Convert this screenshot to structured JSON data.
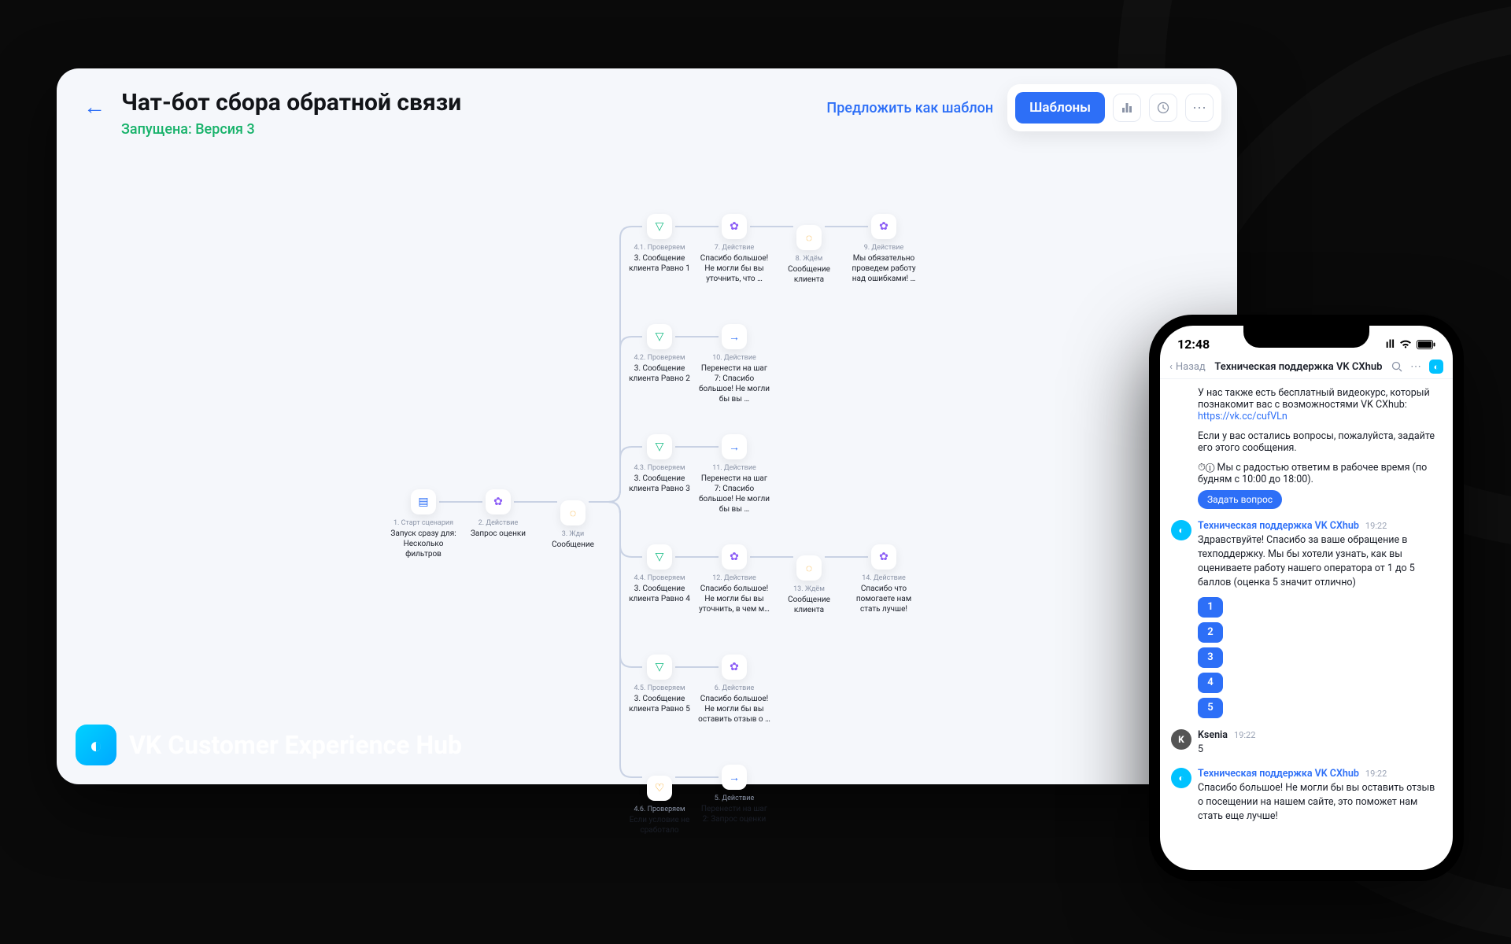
{
  "header": {
    "title": "Чат-бот сбора обратной связи",
    "status": "Запущена: Версия 3"
  },
  "toolbar": {
    "suggest": "Предложить как шаблон",
    "templates": "Шаблоны"
  },
  "brand": {
    "name": "VK Customer Experience Hub",
    "logo": "◐"
  },
  "flow": {
    "base": [
      {
        "cap": "1. Старт сценария",
        "txt": "Запуск сразу для: Несколько фильтров",
        "ic": "cal",
        "g": "▤"
      },
      {
        "cap": "2. Действие",
        "txt": "Запрос оценки",
        "ic": "act",
        "g": "✿"
      },
      {
        "cap": "3. Жди",
        "txt": "Сообщение",
        "ic": "msg",
        "g": "◌"
      }
    ],
    "branches": [
      {
        "check": {
          "cap": "4.1. Проверяем",
          "txt": "3. Сообщение клиента Равно 1"
        },
        "steps": [
          {
            "cap": "7. Действие",
            "txt": "Спасибо большое! Не могли бы вы уточнить, что …",
            "ic": "act",
            "g": "✿"
          },
          {
            "cap": "8. Ждём",
            "txt": "Сообщение клиента",
            "ic": "msg",
            "g": "◌"
          },
          {
            "cap": "9. Действие",
            "txt": "Мы обязательно проведем работу над ошибками! …",
            "ic": "act",
            "g": "✿"
          }
        ]
      },
      {
        "check": {
          "cap": "4.2. Проверяем",
          "txt": "3. Сообщение клиента Равно 2"
        },
        "steps": [
          {
            "cap": "10. Действие",
            "txt": "Перенести на шаг 7: Спасибо большое! Не могли бы вы …",
            "ic": "go",
            "g": "→"
          }
        ]
      },
      {
        "check": {
          "cap": "4.3. Проверяем",
          "txt": "3. Сообщение клиента Равно 3"
        },
        "steps": [
          {
            "cap": "11. Действие",
            "txt": "Перенести на шаг 7: Спасибо большое! Не могли бы вы …",
            "ic": "go",
            "g": "→"
          }
        ]
      },
      {
        "check": {
          "cap": "4.4. Проверяем",
          "txt": "3. Сообщение клиента Равно 4"
        },
        "steps": [
          {
            "cap": "12. Действие",
            "txt": "Спасибо большое! Не могли бы вы уточнить, в чем м…",
            "ic": "act",
            "g": "✿"
          },
          {
            "cap": "13. Ждём",
            "txt": "Сообщение клиента",
            "ic": "msg",
            "g": "◌"
          },
          {
            "cap": "14. Действие",
            "txt": "Спасибо что помогаете нам стать лучше!",
            "ic": "act",
            "g": "✿"
          }
        ]
      },
      {
        "check": {
          "cap": "4.5. Проверяем",
          "txt": "3. Сообщение клиента Равно 5"
        },
        "steps": [
          {
            "cap": "6. Действие",
            "txt": "Спасибо большое! Не могли бы вы оставить отзыв о …",
            "ic": "act",
            "g": "✿"
          }
        ]
      },
      {
        "check": {
          "cap": "4.6. Проверяем",
          "txt": "Если условие не сработало",
          "alt": true
        },
        "steps": [
          {
            "cap": "5. Действие",
            "txt": "Перенести на шаг 2: Запрос оценки",
            "ic": "go",
            "g": "→"
          }
        ]
      }
    ]
  },
  "phone": {
    "time": "12:48",
    "nav": {
      "back": "Назад",
      "title": "Техническая поддержка VK CXhub"
    },
    "intro": {
      "l1": "У нас также есть бесплатный видеокурс, который познакомит вас с возможностями VK CXhub:",
      "link": "https://vk.cc/cufVLn",
      "l2": "Если у вас остались вопросы, пожалуйста, задайте его этого сообщения.",
      "l3": "⏱① Мы с радостью ответим в рабочее время (по будням с 10:00 до 18:00).",
      "ask": "Задать вопрос"
    },
    "m1": {
      "sender": "Техническая поддержка VK CXhub",
      "time": "19:22",
      "body": "Здравствуйте! Спасибо за ваше обращение в техподдержку. Мы бы хотели узнать, как вы оцениваете работу нашего оператора от 1 до 5 баллов (оценка 5 значит отлично)"
    },
    "ratings": [
      "1",
      "2",
      "3",
      "4",
      "5"
    ],
    "m2": {
      "sender": "Ksenia",
      "time": "19:22",
      "body": "5"
    },
    "m3": {
      "sender": "Техническая поддержка VK CXhub",
      "time": "19:22",
      "body": "Спасибо большое! Не могли бы вы оставить отзыв о посещении на нашем сайте, это поможет нам стать еще лучше!"
    }
  }
}
